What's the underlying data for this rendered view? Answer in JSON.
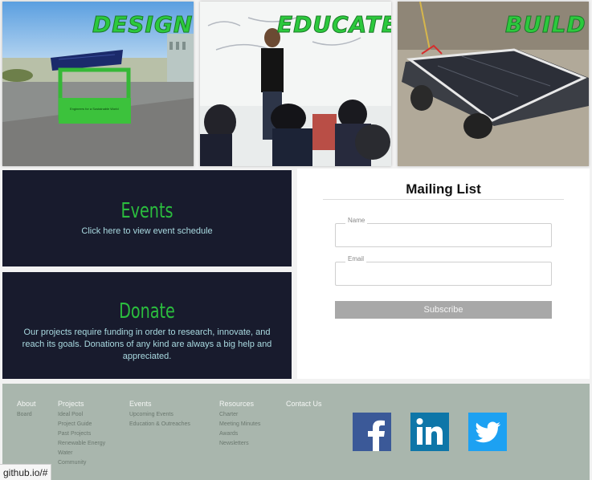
{
  "hero": {
    "design": "DESIGN",
    "educate": "EDUCATE",
    "build": "BUILD",
    "design_kiosk_sign": "Engineers for a Sustainable World"
  },
  "events": {
    "title": "Events",
    "text": "Click here to view event schedule"
  },
  "donate": {
    "title": "Donate",
    "text": "Our projects require funding in order to research, innovate, and reach its goals. Donations of any kind are always a big help and appreciated."
  },
  "mailing": {
    "title": "Mailing List",
    "name_label": "Name",
    "email_label": "Email",
    "name_value": "",
    "email_value": "",
    "subscribe": "Subscribe"
  },
  "footer": {
    "about": {
      "title": "About",
      "items": [
        "Board"
      ]
    },
    "projects": {
      "title": "Projects",
      "items": [
        "Ideal Pool",
        "Project Guide",
        "Past Projects",
        "Renewable Energy",
        "Water",
        "Community"
      ]
    },
    "events": {
      "title": "Events",
      "items": [
        "Upcoming Events",
        "Education & Outreaches"
      ]
    },
    "resources": {
      "title": "Resources",
      "items": [
        "Charter",
        "Meeting Minutes",
        "Awards",
        "Newsletters"
      ]
    },
    "contact": {
      "title": "Contact Us",
      "items": []
    }
  },
  "social": {
    "facebook_color": "#3b5998",
    "linkedin_color": "#0e76a8",
    "twitter_color": "#1da1f2",
    "icons": [
      "facebook-icon",
      "linkedin-icon",
      "twitter-icon"
    ]
  },
  "status_bar": {
    "url": "github.io/#"
  },
  "colors": {
    "accent_green": "#2cc93d",
    "panel_dark": "#181b2d",
    "footer_bg": "#a9b6ad"
  }
}
